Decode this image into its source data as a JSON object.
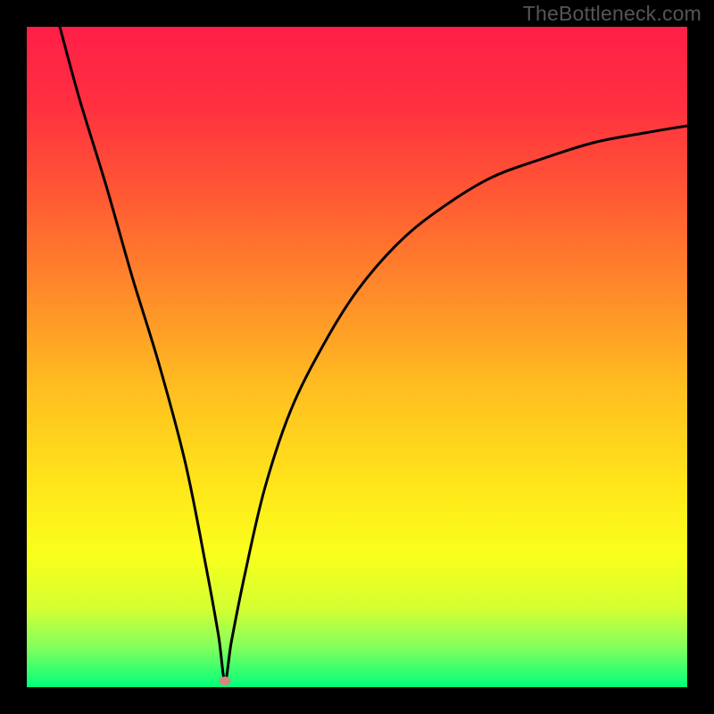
{
  "watermark": "TheBottleneck.com",
  "colors": {
    "black": "#000000",
    "gradient_stops": [
      {
        "offset": 0.0,
        "color": "#ff1f47"
      },
      {
        "offset": 0.12,
        "color": "#ff3040"
      },
      {
        "offset": 0.25,
        "color": "#ff5734"
      },
      {
        "offset": 0.4,
        "color": "#ff8a2a"
      },
      {
        "offset": 0.55,
        "color": "#ffbf20"
      },
      {
        "offset": 0.7,
        "color": "#ffe71a"
      },
      {
        "offset": 0.8,
        "color": "#f9ff1c"
      },
      {
        "offset": 0.88,
        "color": "#d5ff32"
      },
      {
        "offset": 0.94,
        "color": "#82ff5d"
      },
      {
        "offset": 1.0,
        "color": "#00ff7a"
      }
    ],
    "curve_stroke": "#000000",
    "dot_fill": "#cf8a7c"
  },
  "chart_data": {
    "type": "line",
    "title": "",
    "xlabel": "",
    "ylabel": "",
    "xlim": [
      0,
      100
    ],
    "ylim": [
      0,
      100
    ],
    "grid": false,
    "legend": false,
    "annotations": [
      {
        "name": "min-marker",
        "x": 30,
        "y": 1,
        "note": "curve minimum marker (oval dot)"
      }
    ],
    "series": [
      {
        "name": "bottleneck-curve",
        "x": [
          5,
          8,
          12,
          16,
          20,
          24,
          27,
          29,
          30,
          31,
          33,
          36,
          40,
          45,
          50,
          56,
          62,
          70,
          78,
          86,
          94,
          100
        ],
        "y": [
          100,
          89,
          76,
          62,
          49,
          34,
          19,
          8,
          1,
          7,
          17,
          30,
          42,
          52,
          60,
          67,
          72,
          77,
          80,
          82.5,
          84,
          85
        ]
      }
    ]
  }
}
